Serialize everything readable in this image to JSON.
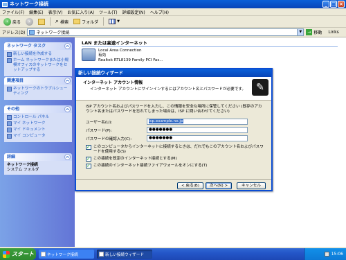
{
  "window": {
    "title": "ネットワーク接続"
  },
  "menu": [
    "ファイル(F)",
    "編集(E)",
    "表示(V)",
    "お気に入り(A)",
    "ツール(T)",
    "詳細設定(N)",
    "ヘルプ(H)"
  ],
  "toolbar": {
    "back": "戻る",
    "search": "検索",
    "folders": "フォルダ"
  },
  "address": {
    "label": "アドレス(D)",
    "value": "ネットワーク接続",
    "go": "移動",
    "links": "Links"
  },
  "sidebar": {
    "network_tasks": {
      "title": "ネットワーク タスク",
      "items": [
        "新しい接続を作成する",
        "ホーム ネットワークまたは小規模オフィスのネットワークをセットアップする"
      ]
    },
    "related": {
      "title": "関連項目",
      "items": [
        "ネットワークのトラブルシューティング"
      ]
    },
    "other_places": {
      "title": "その他",
      "items": [
        "コントロール パネル",
        "マイ ネットワーク",
        "マイ ドキュメント",
        "マイ コンピュータ"
      ]
    },
    "details": {
      "title": "詳細",
      "name": "ネットワーク接続",
      "type": "システム フォルダ"
    }
  },
  "main": {
    "section_title": "LAN または高速インターネット",
    "connection": {
      "name": "Local Area Connection",
      "status": "有効",
      "device": "Realtek RTL8139 Family PCI Fas..."
    }
  },
  "dialog": {
    "title": "新しい接続ウィザード",
    "header_title": "インターネット アカウント情報",
    "header_sub": "インターネット アカウントにサインインするにはアカウント名とパスワードが必要です。",
    "description": "ISP アカウント名およびパスワードを入力し、この情報を安全な場所に保管してください (既存のアカウント名またはパスワードを忘れてしまった場合は、ISP に問い合わせてください)",
    "fields": [
      {
        "label": "ユーザー名(U):",
        "value": "isp.example.ne.jp"
      },
      {
        "label": "パスワード(P):",
        "value": "●●●●●●●"
      },
      {
        "label": "パスワードの確認入力(C):",
        "value": "●●●●●●●"
      }
    ],
    "checks": [
      "このコンピュータからインターネットに接続するときは、だれでもこのアカウント名およびパスワードを使用する(S)",
      "この接続を既定のインターネット接続とする(M)",
      "この接続のインターネット接続ファイアウォールをオンにする(T)"
    ],
    "buttons": {
      "back": "< 戻る(B)",
      "next": "次へ(N) >",
      "cancel": "キャンセル"
    }
  },
  "taskbar": {
    "start": "スタート",
    "tasks": [
      "ネットワーク接続",
      "新しい接続ウィザード"
    ],
    "clock": "15:06"
  }
}
